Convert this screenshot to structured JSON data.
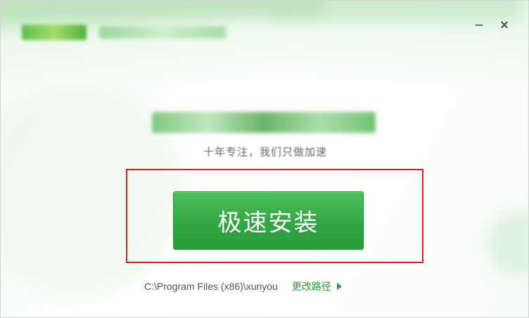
{
  "window": {
    "minimize_glyph": "−",
    "close_glyph": "×"
  },
  "branding": {
    "logo_icon": "app-logo-icon",
    "slogan": "十年专注，我们只做加速"
  },
  "install": {
    "button_label": "极速安装",
    "path": "C:\\Program Files (x86)\\xunyou",
    "change_path_label": "更改路径",
    "change_path_icon": "triangle-right-icon"
  },
  "colors": {
    "accent_green": "#33a644",
    "highlight_red": "#e02020",
    "link_green": "#2f9a34"
  }
}
